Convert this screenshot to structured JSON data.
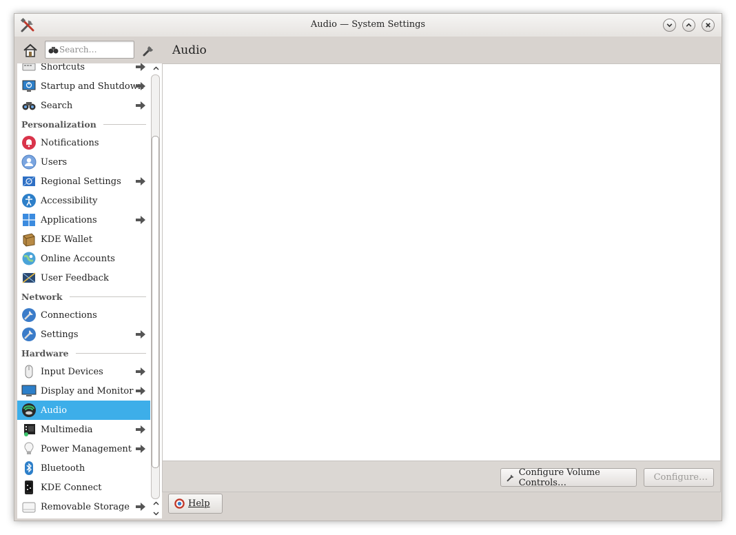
{
  "window": {
    "title": "Audio — System Settings"
  },
  "search": {
    "placeholder": "Search…"
  },
  "sidebar": {
    "items": [
      {
        "type": "item",
        "label": "Shortcuts",
        "icon": "shortcuts-icon",
        "arrow": true
      },
      {
        "type": "item",
        "label": "Startup and Shutdown",
        "icon": "startup-shutdown-icon",
        "arrow": true
      },
      {
        "type": "item",
        "label": "Search",
        "icon": "binoculars-icon",
        "arrow": true
      },
      {
        "type": "category",
        "label": "Personalization"
      },
      {
        "type": "item",
        "label": "Notifications",
        "icon": "bell-icon",
        "arrow": false
      },
      {
        "type": "item",
        "label": "Users",
        "icon": "user-icon",
        "arrow": false
      },
      {
        "type": "item",
        "label": "Regional Settings",
        "icon": "flag-icon",
        "arrow": true
      },
      {
        "type": "item",
        "label": "Accessibility",
        "icon": "accessibility-icon",
        "arrow": false
      },
      {
        "type": "item",
        "label": "Applications",
        "icon": "applications-icon",
        "arrow": true
      },
      {
        "type": "item",
        "label": "KDE Wallet",
        "icon": "wallet-icon",
        "arrow": false
      },
      {
        "type": "item",
        "label": "Online Accounts",
        "icon": "online-accounts-icon",
        "arrow": false
      },
      {
        "type": "item",
        "label": "User Feedback",
        "icon": "user-feedback-icon",
        "arrow": false
      },
      {
        "type": "category",
        "label": "Network"
      },
      {
        "type": "item",
        "label": "Connections",
        "icon": "network-connections-icon",
        "arrow": false
      },
      {
        "type": "item",
        "label": "Settings",
        "icon": "network-settings-icon",
        "arrow": true
      },
      {
        "type": "category",
        "label": "Hardware"
      },
      {
        "type": "item",
        "label": "Input Devices",
        "icon": "mouse-icon",
        "arrow": true
      },
      {
        "type": "item",
        "label": "Display and Monitor",
        "icon": "monitor-icon",
        "arrow": true
      },
      {
        "type": "item",
        "label": "Audio",
        "icon": "audio-icon",
        "arrow": false,
        "selected": true
      },
      {
        "type": "item",
        "label": "Multimedia",
        "icon": "multimedia-icon",
        "arrow": true
      },
      {
        "type": "item",
        "label": "Power Management",
        "icon": "lightbulb-icon",
        "arrow": true
      },
      {
        "type": "item",
        "label": "Bluetooth",
        "icon": "bluetooth-icon",
        "arrow": false
      },
      {
        "type": "item",
        "label": "KDE Connect",
        "icon": "phone-icon",
        "arrow": false
      },
      {
        "type": "item",
        "label": "Removable Storage",
        "icon": "drive-icon",
        "arrow": true
      }
    ]
  },
  "content": {
    "title": "Audio",
    "configure_volume_label": "Configure Volume Controls…",
    "configure_label": "Configure…"
  },
  "footer": {
    "help_label": "Help"
  },
  "colors": {
    "selection": "#3daee9",
    "window_bg": "#d8d3cf"
  }
}
